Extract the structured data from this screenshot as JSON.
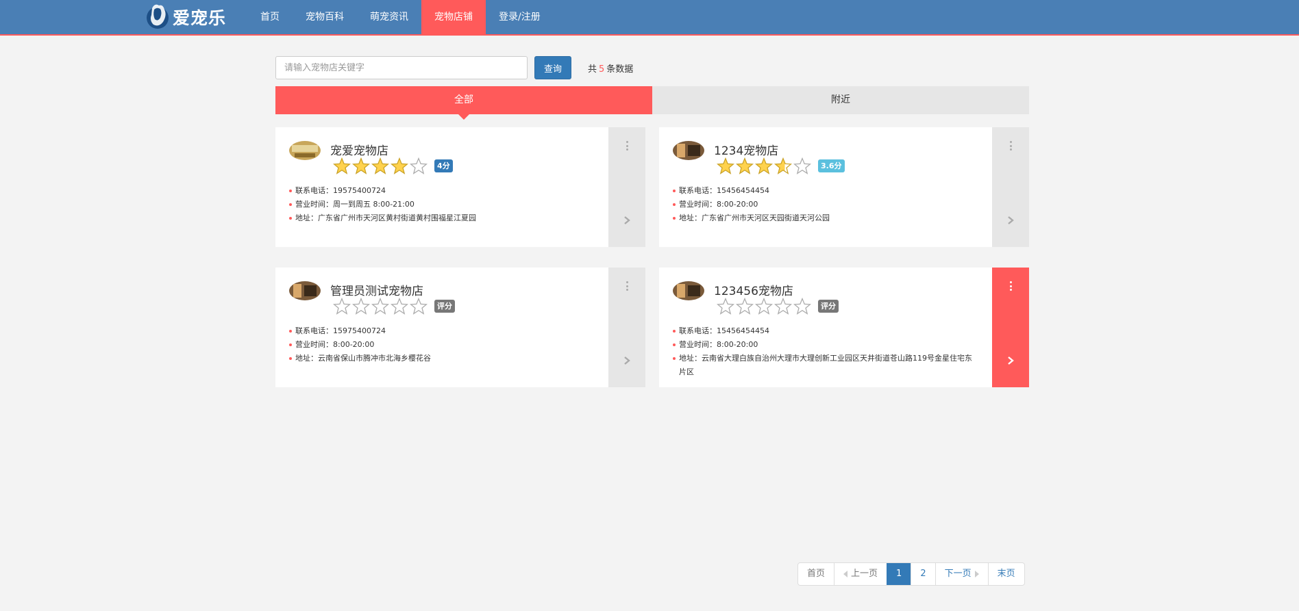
{
  "brand": {
    "name": "爱宠乐"
  },
  "nav": {
    "items": [
      {
        "label": "首页"
      },
      {
        "label": "宠物百科"
      },
      {
        "label": "萌宠资讯"
      },
      {
        "label": "宠物店铺"
      },
      {
        "label": "登录/注册"
      }
    ],
    "active_index": 3
  },
  "search": {
    "placeholder": "请输入宠物店关键字",
    "value": "",
    "button_label": "查询"
  },
  "result": {
    "prefix": "共",
    "count": "5",
    "suffix": "条数据"
  },
  "tabs": [
    {
      "label": "全部"
    },
    {
      "label": "附近"
    }
  ],
  "active_tab": 0,
  "shops": [
    {
      "name": "宠爱宠物店",
      "rating": 4,
      "rating_label": "4分",
      "badge_style": "blue",
      "phone_label": "联系电话：",
      "phone": "19575400724",
      "hours_label": "营业时间：",
      "hours": "周一到周五 8:00-21:00",
      "address_label": "地址：",
      "address": "广东省广州市天河区黄村街道黄村围福星江夏园"
    },
    {
      "name": "1234宠物店",
      "rating": 3.6,
      "rating_label": "3.6分",
      "badge_style": "cyan",
      "phone_label": "联系电话：",
      "phone": "15456454454",
      "hours_label": "营业时间：",
      "hours": "8:00-20:00",
      "address_label": "地址：",
      "address": "广东省广州市天河区天园街道天河公园"
    },
    {
      "name": "管理员测试宠物店",
      "rating": 0,
      "rating_label": "评分",
      "badge_style": "gray",
      "phone_label": "联系电话：",
      "phone": "15975400724",
      "hours_label": "营业时间：",
      "hours": "8:00-20:00",
      "address_label": "地址：",
      "address": "云南省保山市腾冲市北海乡樱花谷"
    },
    {
      "name": "123456宠物店",
      "rating": 0,
      "rating_label": "评分",
      "badge_style": "gray",
      "phone_label": "联系电话：",
      "phone": "15456454454",
      "hours_label": "营业时间：",
      "hours": "8:00-20:00",
      "address_label": "地址：",
      "address": "云南省大理白族自治州大理市大理创新工业园区天井街道苍山路119号金星住宅东片区"
    }
  ],
  "pagination": {
    "first": "首页",
    "prev": "上一页",
    "pages": [
      "1",
      "2"
    ],
    "current": "1",
    "next": "下一页",
    "last": "末页"
  },
  "colors": {
    "navbar": "#4a7fb5",
    "accent": "#ff5a5a",
    "primary": "#337ab7",
    "star": "#ffd24d"
  },
  "icons": {
    "logo": "dog-logo-icon",
    "more": "more-vertical-icon",
    "go": "chevron-right-icon",
    "star": "star-icon"
  }
}
